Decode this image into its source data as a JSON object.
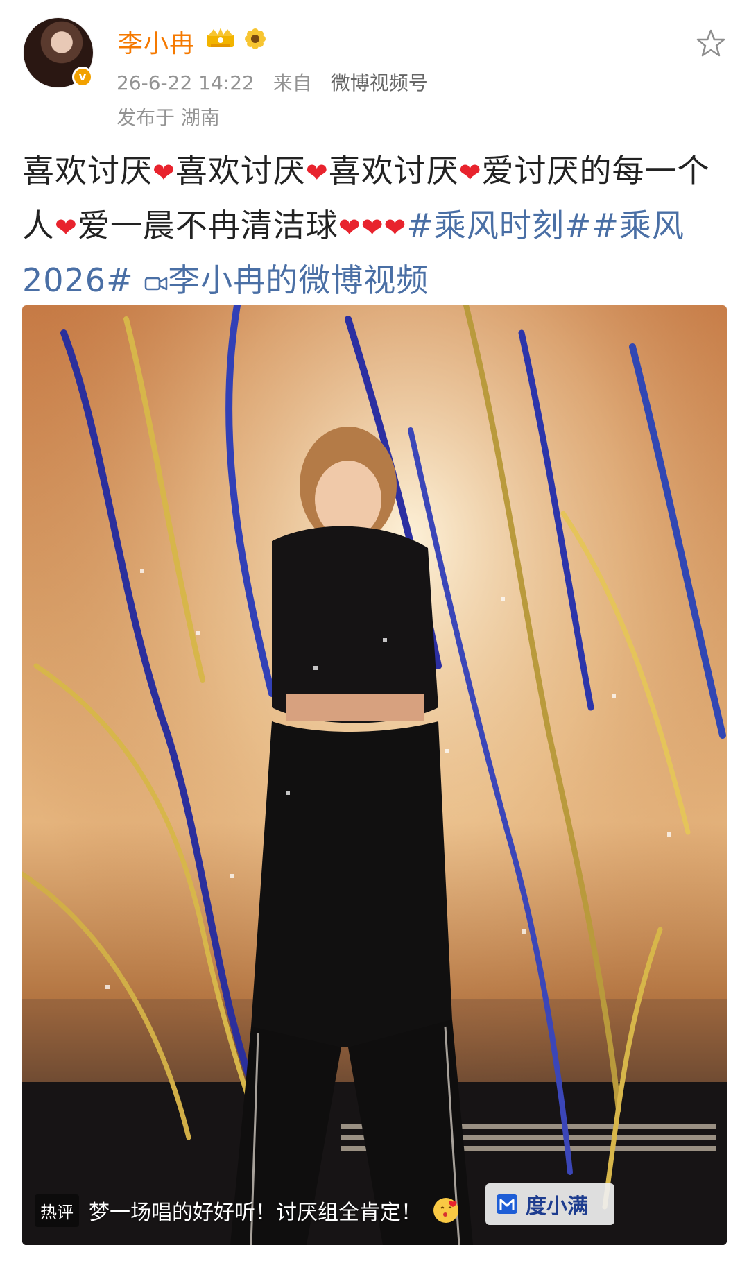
{
  "post": {
    "author": {
      "name": "李小冉",
      "verified_badge": "v"
    },
    "timestamp": "26-6-22 14:22",
    "source_label": "来自",
    "source": "微博视频号",
    "location": "发布于 湖南",
    "content": {
      "segments": [
        {
          "type": "text",
          "value": "喜欢讨厌"
        },
        {
          "type": "heart",
          "value": "❤"
        },
        {
          "type": "text",
          "value": "喜欢讨厌"
        },
        {
          "type": "heart",
          "value": "❤"
        },
        {
          "type": "text",
          "value": "喜欢讨厌"
        },
        {
          "type": "heart",
          "value": "❤"
        },
        {
          "type": "text",
          "value": "爱讨厌的每一个人"
        },
        {
          "type": "heart",
          "value": "❤"
        },
        {
          "type": "text",
          "value": "爱一晨不冉清洁球"
        },
        {
          "type": "heart",
          "value": "❤"
        },
        {
          "type": "heart",
          "value": "❤"
        },
        {
          "type": "heart",
          "value": "❤"
        },
        {
          "type": "tag",
          "value": "#乘风时刻#"
        },
        {
          "type": "tag",
          "value": "#乘风2026#"
        }
      ],
      "video_link": "李小冉的微博视频"
    }
  },
  "video": {
    "hot_comment_label": "热评",
    "hot_comment": "梦一场唱的好好听！讨厌组全肯定！",
    "brand_name": "度小满"
  },
  "colors": {
    "username": "#f57900",
    "link": "#4a6fa5",
    "heart": "#e8232d"
  },
  "icons": [
    "crown-icon",
    "sunflower-icon",
    "star-icon",
    "video-camera-icon",
    "kiss-icon",
    "brand-logo-icon"
  ]
}
